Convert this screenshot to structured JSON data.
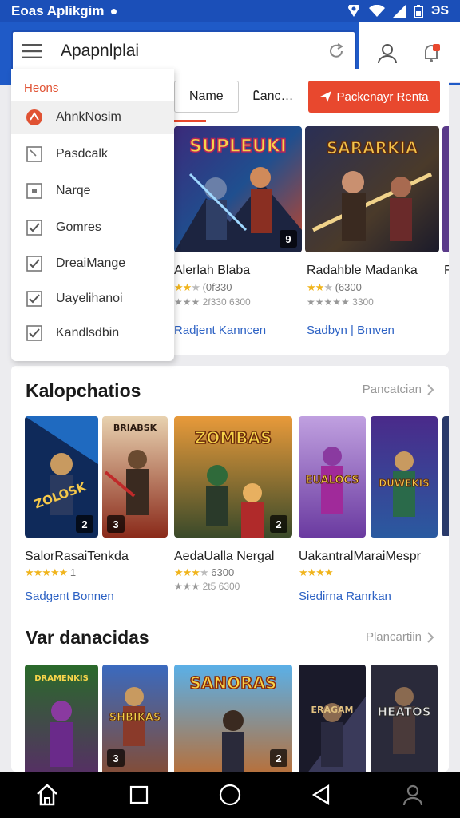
{
  "status": {
    "app_name": "Eoas Aplikgim",
    "time": "ЭS"
  },
  "search": {
    "text": "Apapnlplai"
  },
  "drawer": {
    "header": "Heons",
    "items": [
      {
        "label": "AhnkNosim",
        "icon": "logo-icon",
        "active": true
      },
      {
        "label": "Pasdcalk",
        "icon": "checkbox-icon"
      },
      {
        "label": "Narqe",
        "icon": "checkbox-icon"
      },
      {
        "label": "Gomres",
        "icon": "checkbox-checked-icon"
      },
      {
        "label": "DreaiMange",
        "icon": "checkbox-checked-icon"
      },
      {
        "label": "Uayelihanoi",
        "icon": "checkbox-checked-icon"
      },
      {
        "label": "Kandlsdbin",
        "icon": "checkbox-checked-icon"
      }
    ]
  },
  "chips": {
    "name": "Name",
    "dance": "Ꮭanc…",
    "action": "Packenayr Renta"
  },
  "featured": [
    {
      "art_text": "SUPLEUKI",
      "badge": "9",
      "title": "Alerlah Blaba",
      "rating": "(0f330",
      "subline": "2f330 6300",
      "link": "Radjent Kanncen"
    },
    {
      "art_text": "SARARKIA",
      "badge": "",
      "title": "Radahble Madanka",
      "rating": "(6300",
      "subline": "3300",
      "link": "Sadbyn | Bmven"
    },
    {
      "art_text": "",
      "badge": "",
      "title": "F",
      "rating": "",
      "subline": "",
      "link": ""
    }
  ],
  "section1": {
    "title": "Kalopchatios",
    "more": "Pancatcian",
    "games": [
      {
        "art_text": "ZOLOSK",
        "badge": "2",
        "title": "SalorRasaiTenkda",
        "rating": "1",
        "subline": "",
        "link": "Sadgent Bonnen"
      },
      {
        "art_text": "BRIABSK",
        "badge": "3",
        "title": "",
        "rating": "",
        "subline": "",
        "link": ""
      },
      {
        "art_text": "ZOMBAS",
        "badge": "2",
        "title": "AedaUalla Nergal",
        "rating": "6300",
        "subline": "2t5 6300",
        "link": ""
      },
      {
        "art_text": "EUALOCS",
        "badge": "",
        "title": "UakantralMaraiMespr",
        "rating": "",
        "subline": "",
        "link": "Siedirna Ranrkan"
      },
      {
        "art_text": "DUWEKIS",
        "badge": "",
        "title": "",
        "rating": "",
        "subline": "",
        "link": ""
      }
    ]
  },
  "section2": {
    "title": "Var danacidas",
    "more": "Plancartiin",
    "games": [
      {
        "art_text": "DRAMENKIS",
        "badge": "",
        "title": ""
      },
      {
        "art_text": "SHBIKAS",
        "badge": "3",
        "title": ""
      },
      {
        "art_text": "SANORAS",
        "badge": "2",
        "title": ""
      },
      {
        "art_text": "ERAGAM",
        "badge": "",
        "title": ""
      },
      {
        "art_text": "HEATOS",
        "badge": "",
        "title": ""
      }
    ]
  },
  "colors": {
    "appbar": "#1f5ac7",
    "accent_red": "#e8482e",
    "link_blue": "#2d62c4",
    "star": "#f0b41c"
  }
}
